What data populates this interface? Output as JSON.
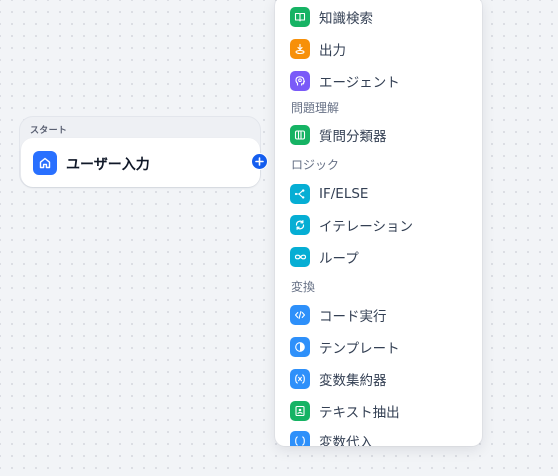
{
  "start_group": {
    "label": "スタート",
    "node_title": "ユーザー入力"
  },
  "panel": {
    "items_a": [
      {
        "label": "知識検索",
        "icon": "book-icon",
        "color": "#16b364"
      },
      {
        "label": "出力",
        "icon": "output-icon",
        "color": "#f79009"
      },
      {
        "label": "エージェント",
        "icon": "agent-icon",
        "color": "#7a5af8"
      }
    ],
    "section_understanding": "問題理解",
    "items_b": [
      {
        "label": "質問分類器",
        "icon": "classifier-icon",
        "color": "#16b364"
      }
    ],
    "section_logic": "ロジック",
    "items_c": [
      {
        "label": "IF/ELSE",
        "icon": "branch-icon",
        "color": "#06aed4"
      },
      {
        "label": "イテレーション",
        "icon": "iteration-icon",
        "color": "#06aed4"
      },
      {
        "label": "ループ",
        "icon": "loop-icon",
        "color": "#06aed4"
      }
    ],
    "section_transform": "変換",
    "items_d": [
      {
        "label": "コード実行",
        "icon": "code-icon",
        "color": "#2e90fa"
      },
      {
        "label": "テンプレート",
        "icon": "template-icon",
        "color": "#2e90fa"
      },
      {
        "label": "変数集約器",
        "icon": "variable-aggregator-icon",
        "color": "#2e90fa"
      },
      {
        "label": "テキスト抽出",
        "icon": "text-extractor-icon",
        "color": "#16b364"
      },
      {
        "label": "変数代入",
        "icon": "variable-assigner-icon",
        "color": "#2e90fa"
      }
    ]
  }
}
